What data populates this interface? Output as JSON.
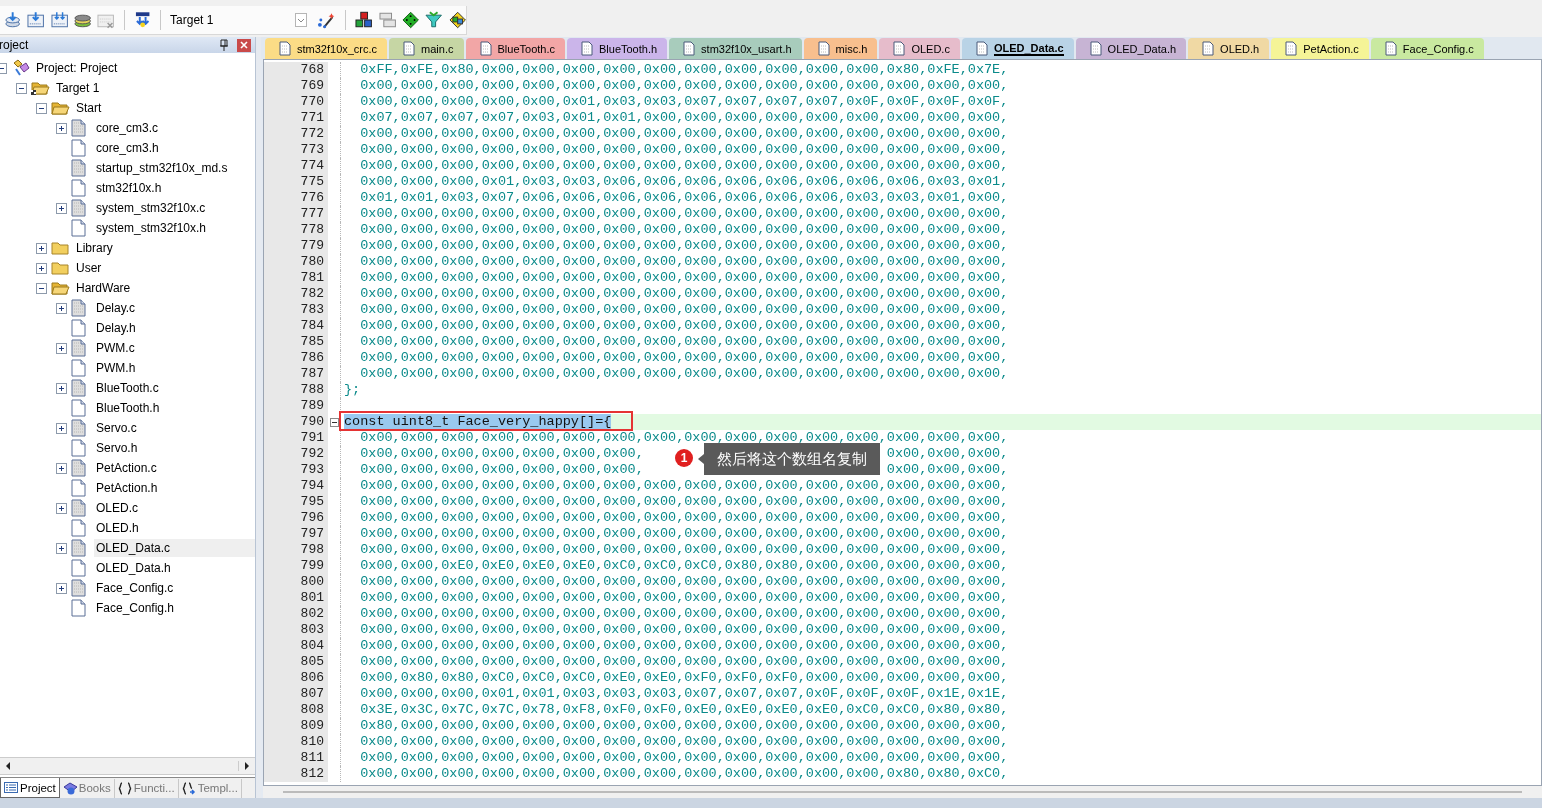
{
  "toolbar": {
    "target": "Target 1"
  },
  "project_panel": {
    "title": "roject",
    "tree": [
      {
        "label": "Project: Project",
        "kind": "project",
        "expanded": true,
        "selected": false,
        "children": [
          {
            "label": "Target 1",
            "kind": "target",
            "expanded": true,
            "selected": false,
            "children": [
              {
                "label": "Start",
                "kind": "folder",
                "expanded": true,
                "selected": false,
                "children": [
                  {
                    "label": "core_cm3.c",
                    "kind": "source",
                    "expanded": false,
                    "selected": false
                  },
                  {
                    "label": "core_cm3.h",
                    "kind": "header",
                    "selected": false
                  },
                  {
                    "label": "startup_stm32f10x_md.s",
                    "kind": "asm",
                    "selected": false
                  },
                  {
                    "label": "stm32f10x.h",
                    "kind": "header",
                    "selected": false
                  },
                  {
                    "label": "system_stm32f10x.c",
                    "kind": "source",
                    "expanded": false,
                    "selected": false
                  },
                  {
                    "label": "system_stm32f10x.h",
                    "kind": "header",
                    "selected": false
                  }
                ]
              },
              {
                "label": "Library",
                "kind": "folder",
                "expanded": false,
                "selected": false
              },
              {
                "label": "User",
                "kind": "folder",
                "expanded": false,
                "selected": false
              },
              {
                "label": "HardWare",
                "kind": "folder",
                "expanded": true,
                "selected": false,
                "children": [
                  {
                    "label": "Delay.c",
                    "kind": "source",
                    "expanded": false,
                    "selected": false
                  },
                  {
                    "label": "Delay.h",
                    "kind": "header",
                    "selected": false
                  },
                  {
                    "label": "PWM.c",
                    "kind": "source",
                    "expanded": false,
                    "selected": false
                  },
                  {
                    "label": "PWM.h",
                    "kind": "header",
                    "selected": false
                  },
                  {
                    "label": "BlueTooth.c",
                    "kind": "source",
                    "expanded": false,
                    "selected": false
                  },
                  {
                    "label": "BlueTooth.h",
                    "kind": "header",
                    "selected": false
                  },
                  {
                    "label": "Servo.c",
                    "kind": "source",
                    "expanded": false,
                    "selected": false
                  },
                  {
                    "label": "Servo.h",
                    "kind": "header",
                    "selected": false
                  },
                  {
                    "label": "PetAction.c",
                    "kind": "source",
                    "expanded": false,
                    "selected": false
                  },
                  {
                    "label": "PetAction.h",
                    "kind": "header",
                    "selected": false
                  },
                  {
                    "label": "OLED.c",
                    "kind": "source",
                    "expanded": false,
                    "selected": false
                  },
                  {
                    "label": "OLED.h",
                    "kind": "header",
                    "selected": false
                  },
                  {
                    "label": "OLED_Data.c",
                    "kind": "source",
                    "expanded": false,
                    "selected": true
                  },
                  {
                    "label": "OLED_Data.h",
                    "kind": "header",
                    "selected": false
                  },
                  {
                    "label": "Face_Config.c",
                    "kind": "source",
                    "expanded": false,
                    "selected": false
                  },
                  {
                    "label": "Face_Config.h",
                    "kind": "header",
                    "selected": false
                  }
                ]
              }
            ]
          }
        ]
      }
    ],
    "tabs": [
      {
        "label": "Project",
        "kind": "project",
        "selected": true
      },
      {
        "label": "Books",
        "kind": "books",
        "selected": false
      },
      {
        "label": "Functi...",
        "kind": "functions",
        "selected": false
      },
      {
        "label": "Templ...",
        "kind": "templates",
        "selected": false
      }
    ]
  },
  "editor": {
    "tabs": [
      {
        "label": "stm32f10x_crc.c",
        "color": "#fbdc86",
        "selected": false
      },
      {
        "label": "main.c",
        "color": "#c6d6a4",
        "selected": false
      },
      {
        "label": "BlueTooth.c",
        "color": "#f2a6a6",
        "selected": false
      },
      {
        "label": "BlueTooth.h",
        "color": "#cbb5ea",
        "selected": false
      },
      {
        "label": "stm32f10x_usart.h",
        "color": "#a8ccbc",
        "selected": false
      },
      {
        "label": "misc.h",
        "color": "#f8bf8e",
        "selected": false
      },
      {
        "label": "OLED.c",
        "color": "#e6bccb",
        "selected": false
      },
      {
        "label": "OLED_Data.c",
        "color": "#b9d3e6",
        "selected": true
      },
      {
        "label": "OLED_Data.h",
        "color": "#c7b4d4",
        "selected": false
      },
      {
        "label": "OLED.h",
        "color": "#f0d9a4",
        "selected": false
      },
      {
        "label": "PetAction.c",
        "color": "#f5f497",
        "selected": false
      },
      {
        "label": "Face_Config.c",
        "color": "#c9e9a0",
        "selected": false
      }
    ],
    "lines": [
      {
        "number": "768",
        "kind": "code",
        "selected": false,
        "text": "  0xFF,0xFE,0x80,0x00,0x00,0x00,0x00,0x00,0x00,0x00,0x00,0x00,0x00,0x80,0xFE,0x7E,"
      },
      {
        "number": "769",
        "kind": "code",
        "selected": false,
        "text": "  0x00,0x00,0x00,0x00,0x00,0x00,0x00,0x00,0x00,0x00,0x00,0x00,0x00,0x00,0x00,0x00,"
      },
      {
        "number": "770",
        "kind": "code",
        "selected": false,
        "text": "  0x00,0x00,0x00,0x00,0x00,0x01,0x03,0x03,0x07,0x07,0x07,0x07,0x0F,0x0F,0x0F,0x0F,"
      },
      {
        "number": "771",
        "kind": "code",
        "selected": false,
        "text": "  0x07,0x07,0x07,0x07,0x03,0x01,0x01,0x00,0x00,0x00,0x00,0x00,0x00,0x00,0x00,0x00,"
      },
      {
        "number": "772",
        "kind": "code",
        "selected": false,
        "text": "  0x00,0x00,0x00,0x00,0x00,0x00,0x00,0x00,0x00,0x00,0x00,0x00,0x00,0x00,0x00,0x00,"
      },
      {
        "number": "773",
        "kind": "code",
        "selected": false,
        "text": "  0x00,0x00,0x00,0x00,0x00,0x00,0x00,0x00,0x00,0x00,0x00,0x00,0x00,0x00,0x00,0x00,"
      },
      {
        "number": "774",
        "kind": "code",
        "selected": false,
        "text": "  0x00,0x00,0x00,0x00,0x00,0x00,0x00,0x00,0x00,0x00,0x00,0x00,0x00,0x00,0x00,0x00,"
      },
      {
        "number": "775",
        "kind": "code",
        "selected": false,
        "text": "  0x00,0x00,0x00,0x01,0x03,0x03,0x06,0x06,0x06,0x06,0x06,0x06,0x06,0x06,0x03,0x01,"
      },
      {
        "number": "776",
        "kind": "code",
        "selected": false,
        "text": "  0x01,0x01,0x03,0x07,0x06,0x06,0x06,0x06,0x06,0x06,0x06,0x06,0x03,0x03,0x01,0x00,"
      },
      {
        "number": "777",
        "kind": "code",
        "selected": false,
        "text": "  0x00,0x00,0x00,0x00,0x00,0x00,0x00,0x00,0x00,0x00,0x00,0x00,0x00,0x00,0x00,0x00,"
      },
      {
        "number": "778",
        "kind": "code",
        "selected": false,
        "text": "  0x00,0x00,0x00,0x00,0x00,0x00,0x00,0x00,0x00,0x00,0x00,0x00,0x00,0x00,0x00,0x00,"
      },
      {
        "number": "779",
        "kind": "code",
        "selected": false,
        "text": "  0x00,0x00,0x00,0x00,0x00,0x00,0x00,0x00,0x00,0x00,0x00,0x00,0x00,0x00,0x00,0x00,"
      },
      {
        "number": "780",
        "kind": "code",
        "selected": false,
        "text": "  0x00,0x00,0x00,0x00,0x00,0x00,0x00,0x00,0x00,0x00,0x00,0x00,0x00,0x00,0x00,0x00,"
      },
      {
        "number": "781",
        "kind": "code",
        "selected": false,
        "text": "  0x00,0x00,0x00,0x00,0x00,0x00,0x00,0x00,0x00,0x00,0x00,0x00,0x00,0x00,0x00,0x00,"
      },
      {
        "number": "782",
        "kind": "code",
        "selected": false,
        "text": "  0x00,0x00,0x00,0x00,0x00,0x00,0x00,0x00,0x00,0x00,0x00,0x00,0x00,0x00,0x00,0x00,"
      },
      {
        "number": "783",
        "kind": "code",
        "selected": false,
        "text": "  0x00,0x00,0x00,0x00,0x00,0x00,0x00,0x00,0x00,0x00,0x00,0x00,0x00,0x00,0x00,0x00,"
      },
      {
        "number": "784",
        "kind": "code",
        "selected": false,
        "text": "  0x00,0x00,0x00,0x00,0x00,0x00,0x00,0x00,0x00,0x00,0x00,0x00,0x00,0x00,0x00,0x00,"
      },
      {
        "number": "785",
        "kind": "code",
        "selected": false,
        "text": "  0x00,0x00,0x00,0x00,0x00,0x00,0x00,0x00,0x00,0x00,0x00,0x00,0x00,0x00,0x00,0x00,"
      },
      {
        "number": "786",
        "kind": "code",
        "selected": false,
        "text": "  0x00,0x00,0x00,0x00,0x00,0x00,0x00,0x00,0x00,0x00,0x00,0x00,0x00,0x00,0x00,0x00,"
      },
      {
        "number": "787",
        "kind": "code",
        "selected": false,
        "text": "  0x00,0x00,0x00,0x00,0x00,0x00,0x00,0x00,0x00,0x00,0x00,0x00,0x00,0x00,0x00,0x00,"
      },
      {
        "number": "788",
        "kind": "code",
        "selected": false,
        "text": "};"
      },
      {
        "number": "789",
        "kind": "code",
        "selected": false
      },
      {
        "number": "790",
        "kind": "fold-start",
        "selected": true,
        "text": "const uint8_t Face_very_happy[]={"
      },
      {
        "number": "791",
        "kind": "code",
        "selected": false,
        "text": "  0x00,0x00,0x00,0x00,0x00,0x00,0x00,0x00,0x00,0x00,0x00,0x00,0x00,0x00,0x00,0x00,"
      },
      {
        "number": "792",
        "kind": "code",
        "selected": false,
        "parts": [
          "  0x00,0x00,0x00,0x00,0x00,0x00,0x00,",
          "0x00,0x00,0x00,"
        ]
      },
      {
        "number": "793",
        "kind": "code",
        "selected": false,
        "parts": [
          "  0x00,0x00,0x00,0x00,0x00,0x00,0x00,",
          "0x00,0x00,0x00,"
        ]
      },
      {
        "number": "794",
        "kind": "code",
        "selected": false,
        "text": "  0x00,0x00,0x00,0x00,0x00,0x00,0x00,0x00,0x00,0x00,0x00,0x00,0x00,0x00,0x00,0x00,"
      },
      {
        "number": "795",
        "kind": "code",
        "selected": false,
        "text": "  0x00,0x00,0x00,0x00,0x00,0x00,0x00,0x00,0x00,0x00,0x00,0x00,0x00,0x00,0x00,0x00,"
      },
      {
        "number": "796",
        "kind": "code",
        "selected": false,
        "text": "  0x00,0x00,0x00,0x00,0x00,0x00,0x00,0x00,0x00,0x00,0x00,0x00,0x00,0x00,0x00,0x00,"
      },
      {
        "number": "797",
        "kind": "code",
        "selected": false,
        "text": "  0x00,0x00,0x00,0x00,0x00,0x00,0x00,0x00,0x00,0x00,0x00,0x00,0x00,0x00,0x00,0x00,"
      },
      {
        "number": "798",
        "kind": "code",
        "selected": false,
        "text": "  0x00,0x00,0x00,0x00,0x00,0x00,0x00,0x00,0x00,0x00,0x00,0x00,0x00,0x00,0x00,0x00,"
      },
      {
        "number": "799",
        "kind": "code",
        "selected": false,
        "text": "  0x00,0x00,0xE0,0xE0,0xE0,0xE0,0xC0,0xC0,0xC0,0x80,0x80,0x00,0x00,0x00,0x00,0x00,"
      },
      {
        "number": "800",
        "kind": "code",
        "selected": false,
        "text": "  0x00,0x00,0x00,0x00,0x00,0x00,0x00,0x00,0x00,0x00,0x00,0x00,0x00,0x00,0x00,0x00,"
      },
      {
        "number": "801",
        "kind": "code",
        "selected": false,
        "text": "  0x00,0x00,0x00,0x00,0x00,0x00,0x00,0x00,0x00,0x00,0x00,0x00,0x00,0x00,0x00,0x00,"
      },
      {
        "number": "802",
        "kind": "code",
        "selected": false,
        "text": "  0x00,0x00,0x00,0x00,0x00,0x00,0x00,0x00,0x00,0x00,0x00,0x00,0x00,0x00,0x00,0x00,"
      },
      {
        "number": "803",
        "kind": "code",
        "selected": false,
        "text": "  0x00,0x00,0x00,0x00,0x00,0x00,0x00,0x00,0x00,0x00,0x00,0x00,0x00,0x00,0x00,0x00,"
      },
      {
        "number": "804",
        "kind": "code",
        "selected": false,
        "text": "  0x00,0x00,0x00,0x00,0x00,0x00,0x00,0x00,0x00,0x00,0x00,0x00,0x00,0x00,0x00,0x00,"
      },
      {
        "number": "805",
        "kind": "code",
        "selected": false,
        "text": "  0x00,0x00,0x00,0x00,0x00,0x00,0x00,0x00,0x00,0x00,0x00,0x00,0x00,0x00,0x00,0x00,"
      },
      {
        "number": "806",
        "kind": "code",
        "selected": false,
        "text": "  0x00,0x80,0x80,0xC0,0xC0,0xC0,0xE0,0xE0,0xF0,0xF0,0xF0,0x00,0x00,0x00,0x00,0x00,"
      },
      {
        "number": "807",
        "kind": "code",
        "selected": false,
        "text": "  0x00,0x00,0x00,0x01,0x01,0x03,0x03,0x03,0x07,0x07,0x07,0x0F,0x0F,0x0F,0x1E,0x1E,"
      },
      {
        "number": "808",
        "kind": "code",
        "selected": false,
        "text": "  0x3E,0x3C,0x7C,0x7C,0x78,0xF8,0xF0,0xF0,0xE0,0xE0,0xE0,0xE0,0xC0,0xC0,0x80,0x80,"
      },
      {
        "number": "809",
        "kind": "code",
        "selected": false,
        "text": "  0x80,0x00,0x00,0x00,0x00,0x00,0x00,0x00,0x00,0x00,0x00,0x00,0x00,0x00,0x00,0x00,"
      },
      {
        "number": "810",
        "kind": "code",
        "selected": false,
        "text": "  0x00,0x00,0x00,0x00,0x00,0x00,0x00,0x00,0x00,0x00,0x00,0x00,0x00,0x00,0x00,0x00,"
      },
      {
        "number": "811",
        "kind": "code",
        "selected": false,
        "text": "  0x00,0x00,0x00,0x00,0x00,0x00,0x00,0x00,0x00,0x00,0x00,0x00,0x00,0x00,0x00,0x00,"
      },
      {
        "number": "812",
        "kind": "code",
        "selected": false,
        "text": "  0x00,0x00,0x00,0x00,0x00,0x00,0x00,0x00,0x00,0x00,0x00,0x00,0x00,0x80,0x80,0xC0,"
      }
    ]
  },
  "callout": {
    "badge": "1",
    "text": "然后将这个数组名复制"
  }
}
